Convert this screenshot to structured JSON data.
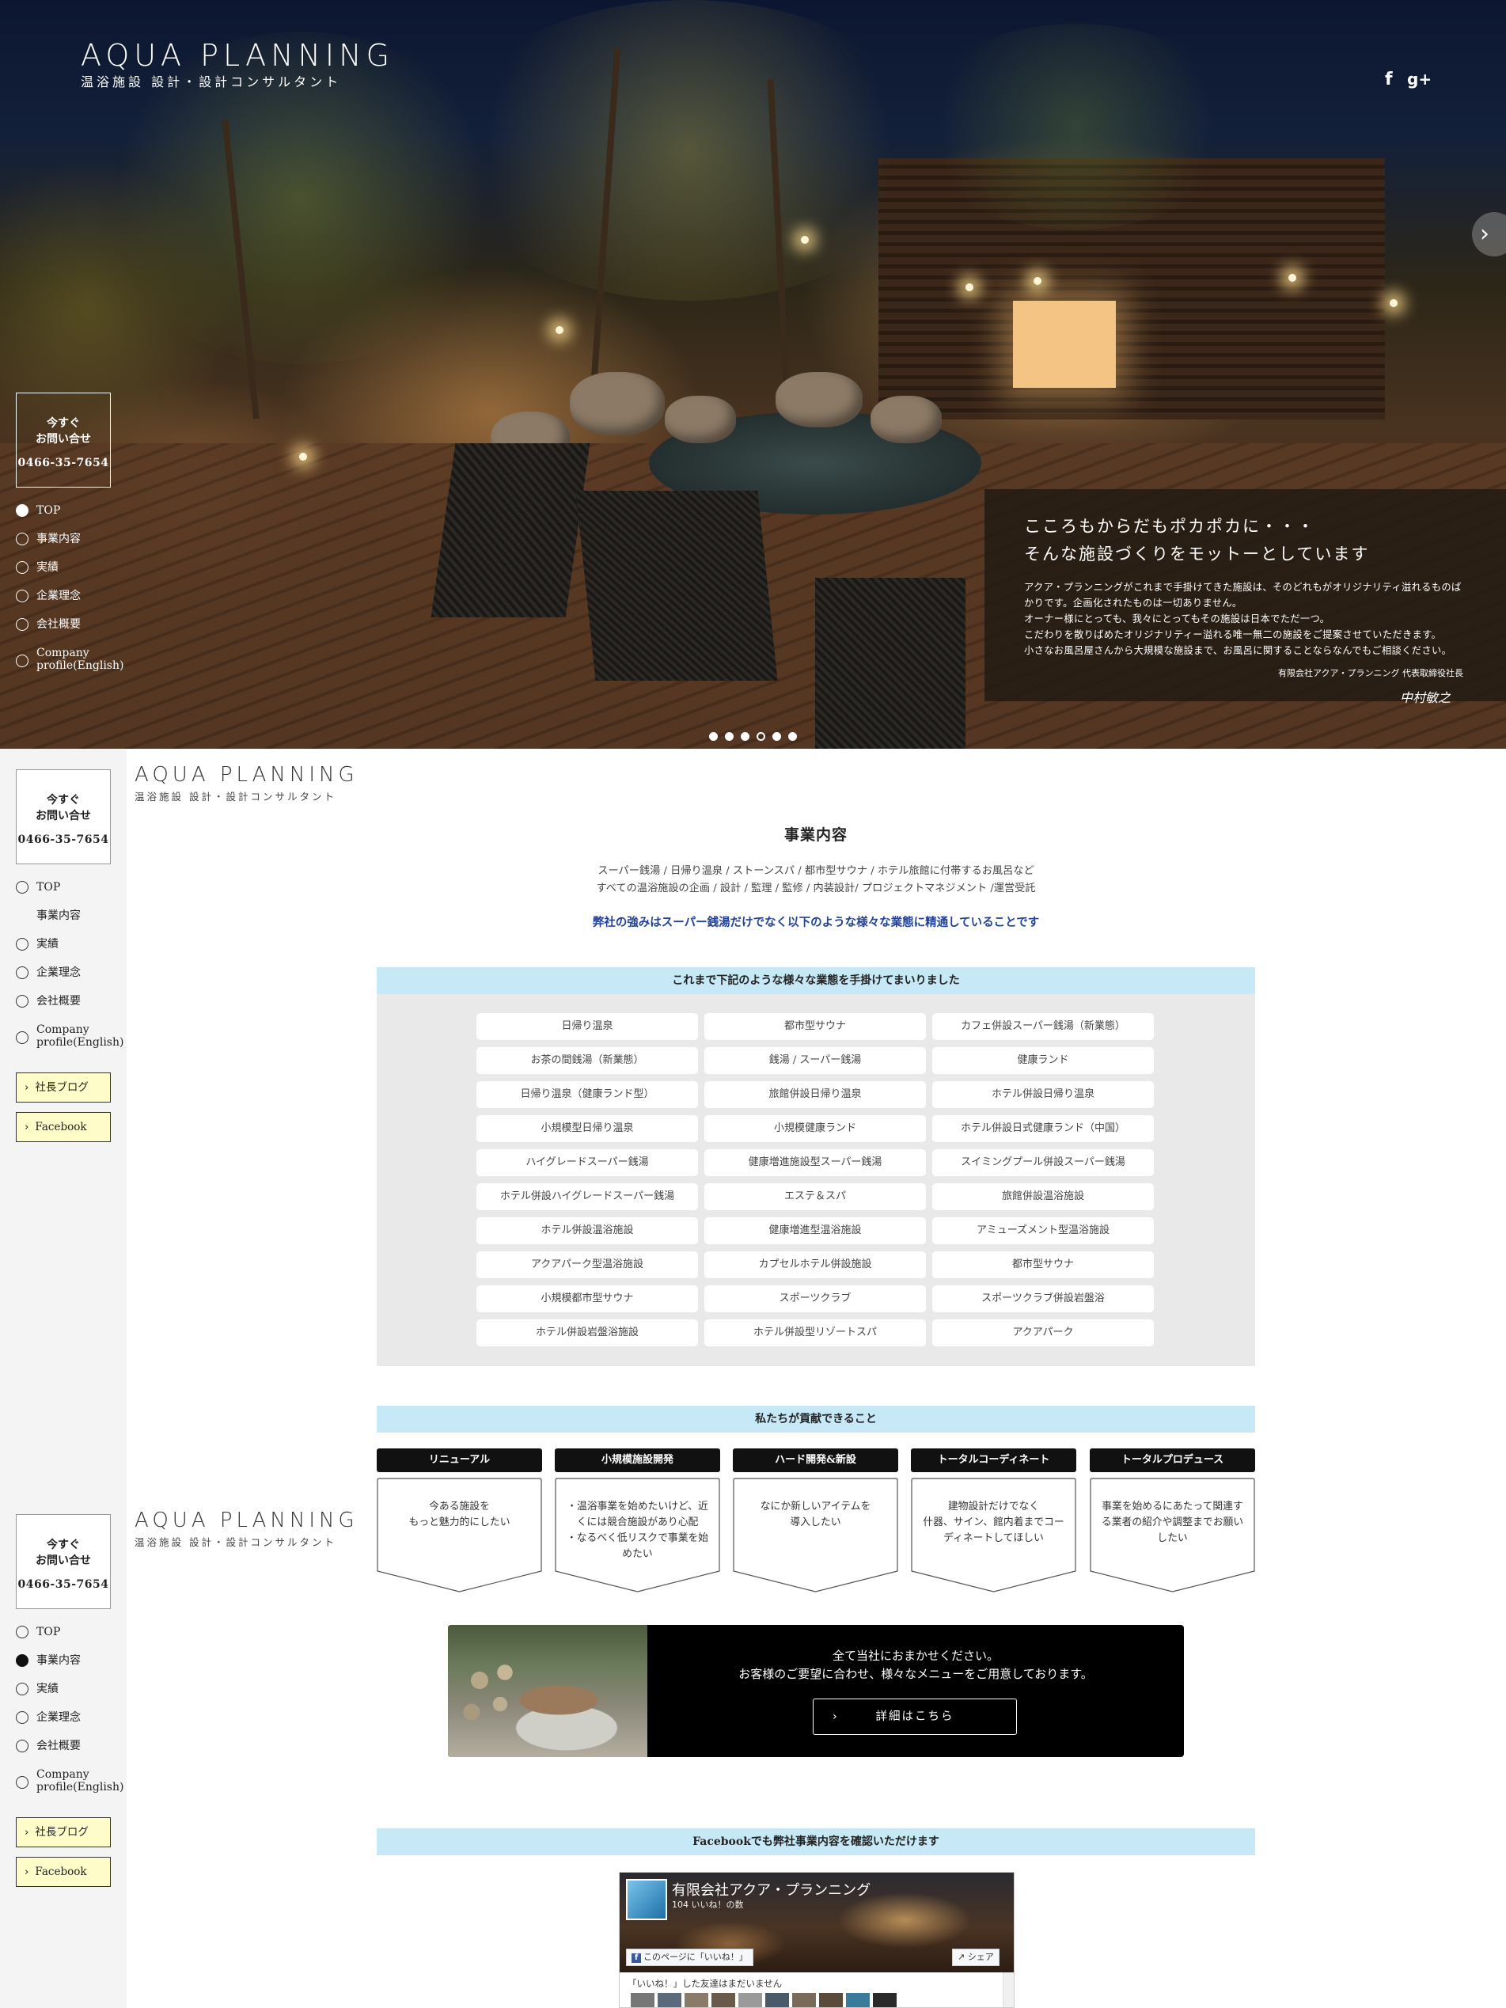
{
  "brand": {
    "name_en": "AQUA PLANNING",
    "tagline": "温浴施設 設計・設計コンサルタント"
  },
  "social": {
    "facebook": "f",
    "googleplus": "g+"
  },
  "hero": {
    "headline": [
      "こころもからだもポカポカに・・・",
      "そんな施設づくりをモットーとしています"
    ],
    "body": "アクア・プランニングがこれまで手掛けてきた施設は、そのどれもがオリジナリティ溢れるものばかりです。企画化されたものは一切ありません。\nオーナー様にとっても、我々にとってもその施設は日本でただ一つ。\nこだわりを散りばめたオリジナリティー溢れる唯一無二の施設をご提案させていただきます。\n小さなお風呂屋さんから大規模な施設まで、お風呂に関することならなんでもご相談ください。",
    "signer": "有限会社アクア・プランニング 代表取締役社長",
    "signature": "中村敏之",
    "slides": {
      "count": 6,
      "active_index": 3
    }
  },
  "contact": {
    "line1": "今すぐ",
    "line2": "お問い合せ",
    "phone": "0466-35-7654"
  },
  "nav": [
    {
      "label": "TOP"
    },
    {
      "label": "事業内容"
    },
    {
      "label": "実績"
    },
    {
      "label": "企業理念"
    },
    {
      "label": "会社概要"
    },
    {
      "label": "Company profile(English)"
    }
  ],
  "side_buttons": {
    "blog": "社長ブログ",
    "facebook": "Facebook"
  },
  "business": {
    "title": "事業内容",
    "desc_line1": "スーパー銭湯 / 日帰り温泉 / ストーンスパ / 都市型サウナ / ホテル旅館に付帯するお風呂など",
    "desc_line2": "すべての温浴施設の企画 / 設計 / 監理 / 監修 / 内装設計/ プロジェクトマネジメント /運営受託",
    "strength": "弊社の強みはスーパー銭湯だけでなく以下のような様々な業態に精通していることです",
    "types_heading": "これまで下記のような様々な業態を手掛けてまいりました",
    "types": [
      "日帰り温泉",
      "都市型サウナ",
      "カフェ併設スーパー銭湯（新業態）",
      "お茶の間銭湯（新業態）",
      "銭湯 / スーパー銭湯",
      "健康ランド",
      "日帰り温泉（健康ランド型）",
      "旅館併設日帰り温泉",
      "ホテル併設日帰り温泉",
      "小規模型日帰り温泉",
      "小規模健康ランド",
      "ホテル併設日式健康ランド（中国）",
      "ハイグレードスーパー銭湯",
      "健康増進施設型スーパー銭湯",
      "スイミングプール併設スーパー銭湯",
      "ホテル併設ハイグレードスーパー銭湯",
      "エステ＆スパ",
      "旅館併設温浴施設",
      "ホテル併設温浴施設",
      "健康増進型温浴施設",
      "アミューズメント型温浴施設",
      "アクアパーク型温浴施設",
      "カプセルホテル併設施設",
      "都市型サウナ",
      "小規模都市型サウナ",
      "スポーツクラブ",
      "スポーツクラブ併設岩盤浴",
      "ホテル併設岩盤浴施設",
      "ホテル併設型リゾートスパ",
      "アクアパーク"
    ],
    "contrib_heading": "私たちが貢献できること",
    "contrib": [
      {
        "title": "リニューアル",
        "text": "今ある施設を\nもっと魅力的にしたい"
      },
      {
        "title": "小規模施設開発",
        "text": "・温浴事業を始めたいけど、近くには競合施設があり心配\n・なるべく低リスクで事業を始めたい"
      },
      {
        "title": "ハード開発&新設",
        "text": "なにか新しいアイテムを\n導入したい"
      },
      {
        "title": "トータルコーディネート",
        "text": "建物設計だけでなく\n什器、サイン、館内着までコーディネートしてほしい"
      },
      {
        "title": "トータルプロデュース",
        "text": "事業を始めるにあたって関連する業者の紹介や調整までお願いしたい"
      }
    ],
    "promo_text": "全て当社におまかせください。\nお客様のご要望に合わせ、様々なメニューをご用意しております。",
    "promo_button": "詳細はこちら",
    "fb_heading": "Facebookでも弊社事業内容を確認いただけます"
  },
  "fb_widget": {
    "page_name": "有限会社アクア・プランニング",
    "likes": "104 いいね！の数",
    "like_button": "このページに「いいね！」",
    "share_button": "シェア",
    "friends_text": "「いいね！」した友達はまだいません"
  },
  "colors": {
    "band": "#c7e9f7",
    "strength_text": "#22429a",
    "button_yellow": "#fefdc9"
  }
}
